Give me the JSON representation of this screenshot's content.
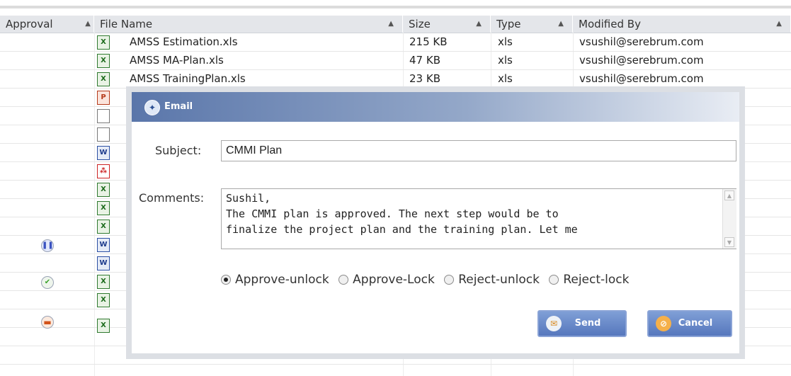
{
  "columns": {
    "approval": "Approval",
    "file_name": "File Name",
    "size": "Size",
    "type": "Type",
    "modified_by": "Modified By",
    "sort_icon": "sort-ascending-icon"
  },
  "rows": [
    {
      "name": "AMSS Estimation.xls",
      "size": "215 KB",
      "type": "xls",
      "modified_by": "vsushil@serebrum.com"
    },
    {
      "name": "AMSS MA-Plan.xls",
      "size": "47 KB",
      "type": "xls",
      "modified_by": "vsushil@serebrum.com"
    },
    {
      "name": "AMSS TrainingPlan.xls",
      "size": "23 KB",
      "type": "xls",
      "modified_by": "vsushil@serebrum.com"
    }
  ],
  "file_icons": [
    "excel",
    "excel",
    "excel",
    "powerpoint",
    "blank",
    "blank",
    "word",
    "pdf",
    "excel",
    "excel",
    "excel",
    "word",
    "word",
    "excel",
    "excel",
    "excel"
  ],
  "approval_icons": [
    {
      "row": 10,
      "icon": "pending-icon"
    },
    {
      "row": 12,
      "icon": "approved-icon"
    },
    {
      "row": 14,
      "icon": "locked-icon"
    }
  ],
  "email": {
    "title": "Email",
    "subject_label": "Subject:",
    "subject_value": "CMMI Plan",
    "comments_label": "Comments:",
    "comments_value": "Sushil,\nThe CMMI plan is approved. The next step would be to\nfinalize the project plan and the training plan. Let me",
    "options": [
      "Approve-unlock",
      "Approve-Lock",
      "Reject-unlock",
      "Reject-lock"
    ],
    "selected_option": "Approve-unlock",
    "send_label": "Send",
    "cancel_label": "Cancel"
  }
}
